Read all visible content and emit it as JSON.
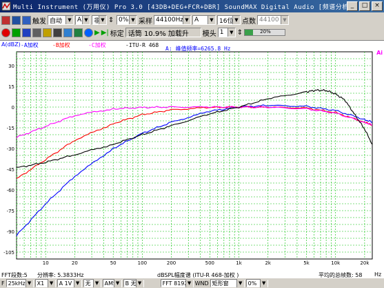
{
  "window": {
    "title": "Multi Instrument (万用仪) Pro 3.0  [43DB+DEG+FCR+DBR]  SoundMAX Digital Audio  [频谱分析仪]"
  },
  "toolbar1": {
    "trigger_label": "触发",
    "trigger_mode": "自动",
    "ch_a": "A",
    "ch_a_op": "非",
    "zoom_pct": "0%",
    "sampling_label": "采样",
    "sample_rate": "44100Hz",
    "channel": "A",
    "bits": "16位",
    "points_label": "点数",
    "points": "44100"
  },
  "toolbar2": {
    "calibrate_label": "标定",
    "overrange_text": "话筒 10.9% 加载升",
    "ch_label": "模头",
    "ch_value": "1"
  },
  "level_meter": {
    "percent": 20,
    "label": "20%"
  },
  "plot": {
    "left_label": "A(dBZ)",
    "right_label": "Ai",
    "peak_label": "A: 峰值频率=6265.8 Hz",
    "curves_legend": [
      {
        "name": "-A加权",
        "color": "#0000ff"
      },
      {
        "name": "-B加权",
        "color": "#ff0000"
      },
      {
        "name": "-C加权",
        "color": "#ff00ff"
      },
      {
        "name": "-ITU-R 468",
        "color": "#000000"
      }
    ],
    "x_axis_title": "dBSPL幅度谱 (ITU-R 468-加权 )",
    "x_unit": "Hz",
    "average_label": "平均的总帧数: 58",
    "status_left": "FFT段数:5",
    "resolution": "分辨率: 5.3833Hz"
  },
  "chart_data": {
    "type": "line",
    "xscale": "log",
    "xlim": [
      5,
      24000
    ],
    "ylim": [
      -110,
      40
    ],
    "y_ticks": [
      30,
      15,
      0,
      -15,
      -30,
      -45,
      -60,
      -75,
      -90,
      -105
    ],
    "x_ticks": [
      {
        "value": 10,
        "label": "10"
      },
      {
        "value": 20,
        "label": "20"
      },
      {
        "value": 50,
        "label": "50"
      },
      {
        "value": 100,
        "label": "100"
      },
      {
        "value": 200,
        "label": "200"
      },
      {
        "value": 500,
        "label": "500"
      },
      {
        "value": 1000,
        "label": "1k"
      },
      {
        "value": 2000,
        "label": "2k"
      },
      {
        "value": 5000,
        "label": "5k"
      },
      {
        "value": 10000,
        "label": "10k"
      },
      {
        "value": 20000,
        "label": "20k"
      }
    ],
    "grid": true,
    "series": [
      {
        "name": "A加权",
        "color": "#0000ff",
        "x": [
          5,
          10,
          20,
          50,
          100,
          200,
          500,
          1000,
          2000,
          5000,
          10000,
          20000,
          24000
        ],
        "y": [
          -93,
          -70,
          -50,
          -30,
          -19,
          -11,
          -3,
          0,
          1.2,
          0.5,
          -2.5,
          -9,
          -11
        ]
      },
      {
        "name": "B加权",
        "color": "#ff0000",
        "x": [
          5,
          10,
          20,
          50,
          100,
          200,
          500,
          1000,
          2000,
          5000,
          10000,
          20000,
          24000
        ],
        "y": [
          -52,
          -38,
          -24,
          -12,
          -5.5,
          -2,
          -0.3,
          0,
          -0.1,
          -0.7,
          -4,
          -11,
          -13
        ]
      },
      {
        "name": "C加权",
        "color": "#ff00ff",
        "x": [
          5,
          10,
          20,
          50,
          100,
          200,
          500,
          1000,
          2000,
          5000,
          10000,
          20000,
          24000
        ],
        "y": [
          -22,
          -14,
          -6,
          -1.3,
          -0.3,
          0,
          0,
          0,
          -0.2,
          -1.3,
          -4.4,
          -11,
          -13
        ]
      },
      {
        "name": "ITU-R 468",
        "color": "#000000",
        "x": [
          5,
          10,
          20,
          50,
          100,
          200,
          500,
          1000,
          2000,
          5000,
          6300,
          8000,
          10000,
          12500,
          16000,
          20000,
          24000
        ],
        "y": [
          -44,
          -40,
          -34.5,
          -27,
          -20,
          -13.5,
          -5,
          0,
          6,
          11,
          12.2,
          12,
          9.5,
          5,
          -6,
          -16,
          -27
        ]
      }
    ]
  }
}
